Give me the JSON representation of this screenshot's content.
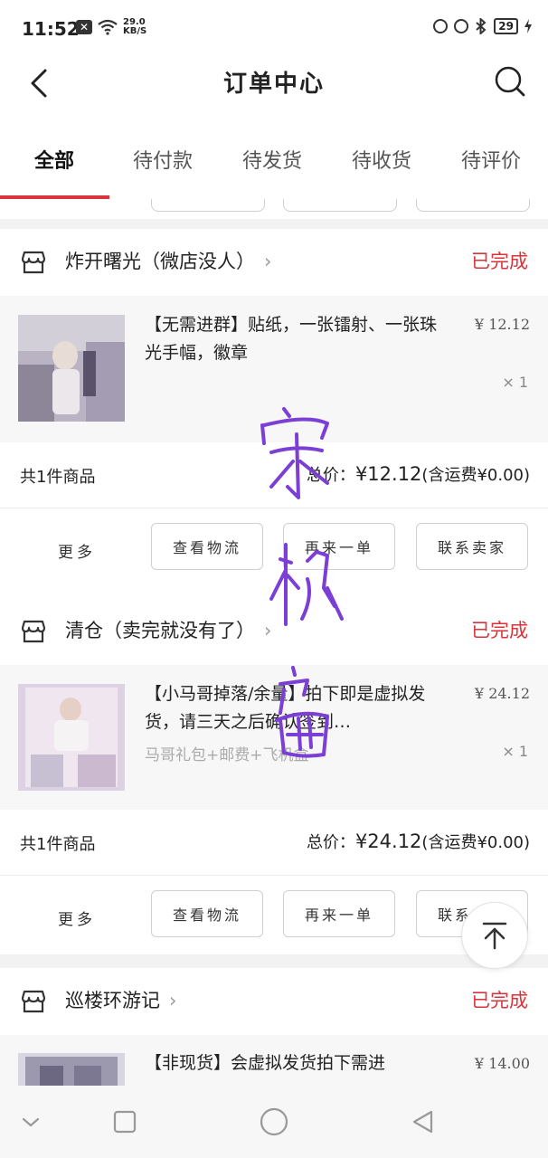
{
  "status_bar": {
    "time": "11:52",
    "net_speed_value": "29.0",
    "net_speed_unit": "KB/S",
    "battery": "29"
  },
  "header": {
    "title": "订单中心"
  },
  "tabs": [
    {
      "label": "全部",
      "active": true
    },
    {
      "label": "待付款",
      "active": false
    },
    {
      "label": "待发货",
      "active": false
    },
    {
      "label": "待收货",
      "active": false
    },
    {
      "label": "待评价",
      "active": false
    }
  ],
  "orders": [
    {
      "store": "炸开曙光（微店没人）",
      "status": "已完成",
      "item_title": "【无需进群】贴纸，一张镭射、一张珠光手幅，徽章",
      "item_sub": "",
      "price": "¥ 12.12",
      "qty": "× 1",
      "count_text": "共1件商品",
      "total_label": "总价：",
      "total_amount": "¥12.12",
      "shipping": "(含运费¥0.00)",
      "more": "更多",
      "buttons": [
        "查看物流",
        "再来一单",
        "联系卖家"
      ]
    },
    {
      "store": "清仓（卖完就没有了）",
      "status": "已完成",
      "item_title": "【小马哥掉落/余量】拍下即是虚拟发货，请三天之后确认签到…",
      "item_sub": "马哥礼包+邮费+飞机盒",
      "price": "¥ 24.12",
      "qty": "× 1",
      "count_text": "共1件商品",
      "total_label": "总价：",
      "total_amount": "¥24.12",
      "shipping": "(含运费¥0.00)",
      "more": "更多",
      "buttons": [
        "查看物流",
        "再来一单",
        "联系卖家"
      ]
    },
    {
      "store": "巡楼环游记",
      "status": "已完成",
      "item_title": "【非现货】会虚拟发货拍下需进",
      "price": "¥ 14.00"
    }
  ],
  "colors": {
    "accent": "#d9333c",
    "signature": "#7b3fd6"
  },
  "icons": [
    "back-icon",
    "search-icon",
    "store-icon",
    "chevron-right-icon",
    "back-to-top-icon",
    "nav-down-icon",
    "nav-recent-icon",
    "nav-home-icon",
    "nav-back-icon"
  ]
}
